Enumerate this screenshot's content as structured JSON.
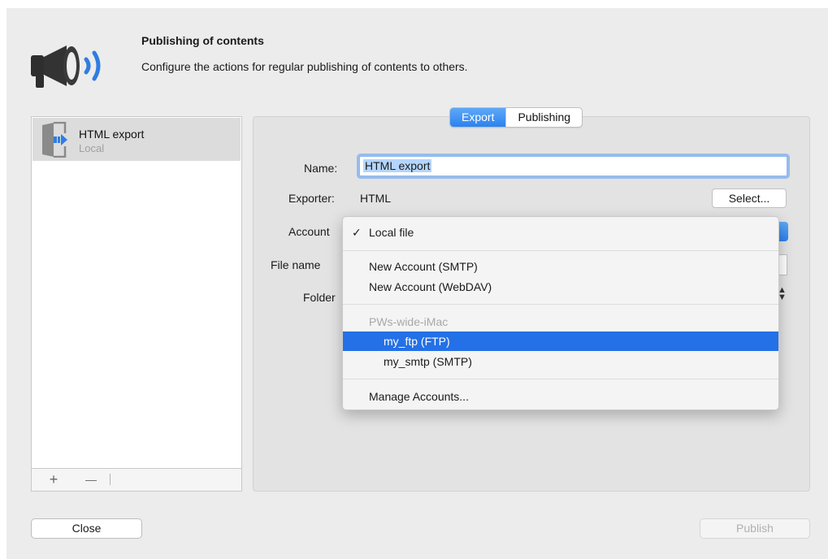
{
  "header": {
    "title": "Publishing of contents",
    "subtitle": "Configure the actions for regular publishing of contents to others.",
    "icon": "megaphone-icon"
  },
  "sidebar": {
    "items": [
      {
        "label": "HTML export",
        "sublabel": "Local",
        "icon": "export-document-icon",
        "selected": true
      }
    ],
    "add_label": "+",
    "remove_label": "—"
  },
  "tabs": [
    {
      "label": "Export",
      "active": true
    },
    {
      "label": "Publishing",
      "active": false
    }
  ],
  "form": {
    "name_label": "Name:",
    "name_value": "HTML export",
    "exporter_label": "Exporter:",
    "exporter_value": "HTML",
    "select_label": "Select...",
    "account_label": "Account",
    "file_name_label": "File name",
    "folder_label": "Folder"
  },
  "account_menu": {
    "check": "✓",
    "items": [
      {
        "label": "Local file",
        "checked": true
      },
      {
        "label": "New Account (SMTP)"
      },
      {
        "label": "New Account (WebDAV)"
      },
      {
        "label": "PWs-wide-iMac",
        "disabled": true
      },
      {
        "label": "my_ftp (FTP)",
        "highlighted": true
      },
      {
        "label": "my_smtp (SMTP)"
      },
      {
        "label": "Manage Accounts..."
      }
    ]
  },
  "footer": {
    "close_label": "Close",
    "publish_label": "Publish"
  },
  "colors": {
    "accent": "#2470e6",
    "window_bg": "#ececec",
    "icon_blue": "#2f7de1"
  }
}
